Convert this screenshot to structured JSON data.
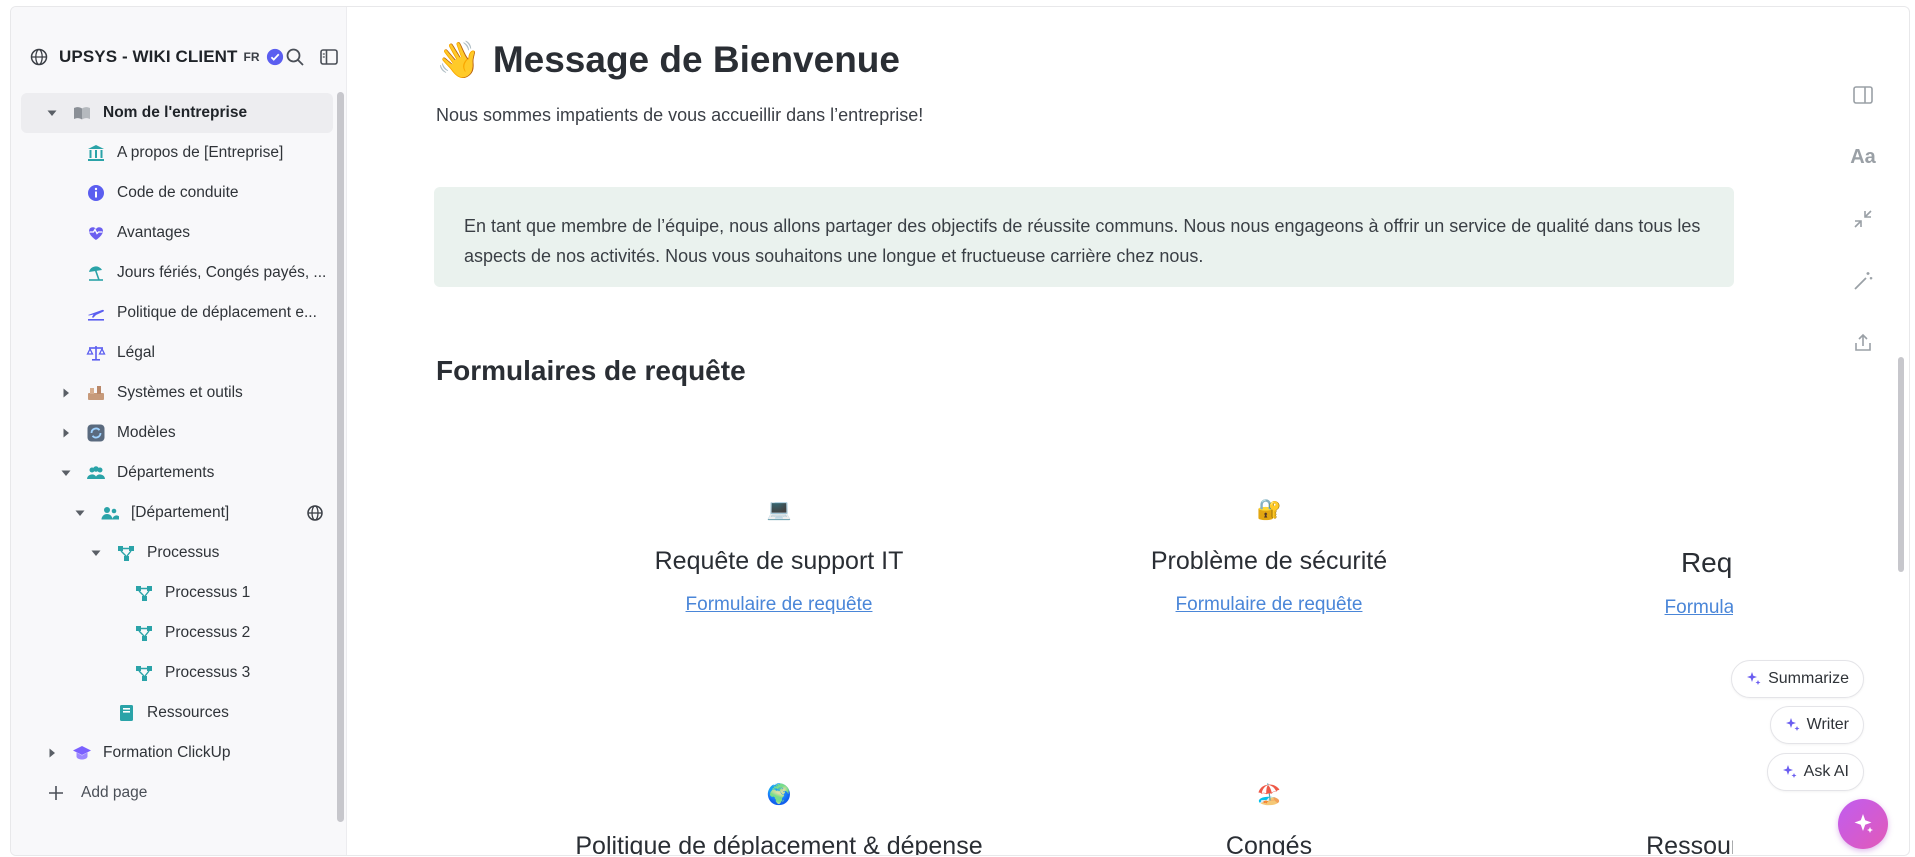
{
  "sidebar": {
    "title": "UPSYS - WIKI CLIENT",
    "lang": "FR",
    "add_page": "Add page",
    "items": [
      {
        "label": "Nom de l'entreprise",
        "icon": "book-icon"
      },
      {
        "label": "A propos de [Entreprise]",
        "icon": "bank-icon"
      },
      {
        "label": "Code de conduite",
        "icon": "info-icon"
      },
      {
        "label": "Avantages",
        "icon": "heart-pulse-icon"
      },
      {
        "label": "Jours fériés, Congés payés, ...",
        "icon": "beach-umbrella-icon"
      },
      {
        "label": "Politique de déplacement e...",
        "icon": "airplane-icon"
      },
      {
        "label": "Légal",
        "icon": "scales-icon"
      },
      {
        "label": "Systèmes et outils",
        "icon": "tools-icon"
      },
      {
        "label": "Modèles",
        "icon": "refresh-icon"
      },
      {
        "label": "Départements",
        "icon": "people-icon"
      },
      {
        "label": "[Département]",
        "icon": "person-group-icon"
      },
      {
        "label": "Processus",
        "icon": "flow-icon"
      },
      {
        "label": "Processus 1",
        "icon": "flow-icon"
      },
      {
        "label": "Processus 2",
        "icon": "flow-icon"
      },
      {
        "label": "Processus 3",
        "icon": "flow-icon"
      },
      {
        "label": "Ressources",
        "icon": "notebook-icon"
      },
      {
        "label": "Formation ClickUp",
        "icon": "graduation-icon"
      }
    ]
  },
  "page": {
    "emoji": "👋",
    "title": "Message de Bienvenue",
    "subtitle": "Nous sommes impatients de vous accueillir dans l’entreprise!",
    "callout": "En tant que membre de l’équipe, nous allons partager des objectifs de réussite communs. Nous nous engageons à offrir un service de qualité dans tous les aspects de nos activités. Nous vous souhaitons une longue et fructueuse carrière chez nous.",
    "section_title": "Formulaires de requête",
    "cards": [
      {
        "icon": "💻",
        "title": "Requête de support IT",
        "link": "Formulaire de requête"
      },
      {
        "icon": "🔐",
        "title": "Problème de sécurité",
        "link": "Formulaire de requête"
      },
      {
        "icon": "👥",
        "title": "Requête RH",
        "link": "Formulaire de requête"
      },
      {
        "icon": "🌍",
        "title": "Politique de déplacement & dépense",
        "link": ""
      },
      {
        "icon": "🏖️",
        "title": "Congés",
        "link": ""
      },
      {
        "icon": "✅",
        "title": "Ressources de prod",
        "link": ""
      }
    ]
  },
  "ai": {
    "summarize": "Summarize",
    "writer": "Writer",
    "ask_ai": "Ask AI"
  },
  "colors": {
    "accent": "#4a86d8",
    "teal": "#2aa3a8",
    "callout_bg": "#eaf2ee",
    "ai_purple": "#7b61ff"
  }
}
